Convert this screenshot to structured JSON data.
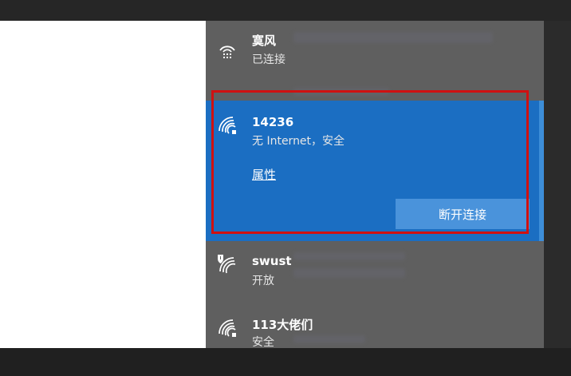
{
  "networks": [
    {
      "name": "寞风",
      "status": "已连接",
      "icon": "ethernet-icon"
    },
    {
      "name": "14236",
      "status": "无 Internet，安全",
      "icon": "wifi-secure-icon",
      "properties_label": "属性",
      "action_label": "断开连接",
      "selected": true
    },
    {
      "name": "swust",
      "status": "开放",
      "icon": "wifi-open-shield-icon"
    },
    {
      "name": "113大佬们",
      "status": "安全",
      "icon": "wifi-secure-icon"
    }
  ],
  "colors": {
    "flyout_bg": "#5f5f5f",
    "selected_bg": "#1b6ec2",
    "button_bg": "#4a93db",
    "highlight_border": "#d01010"
  }
}
